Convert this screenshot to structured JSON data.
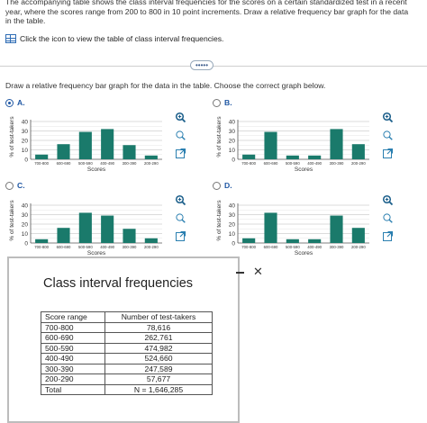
{
  "intro": "The accompanying table shows the class interval frequencies for the scores on a certain standardized test in a recent year, where the scores range from 200 to 800 in 10 point increments. Draw a relative frequency bar graph for the data in the table.",
  "table_link": "Click the icon to view the table of class interval frequencies.",
  "more_button": "•••••",
  "question": "Draw a relative frequency bar graph for the data in the table. Choose the correct graph below.",
  "graph_axes": {
    "ylabel": "% of test-takers",
    "xlabel": "Scores",
    "yticks": [
      "0",
      "10",
      "20",
      "30",
      "40"
    ]
  },
  "chart_data": [
    {
      "option": "A.",
      "selected": true,
      "type": "bar",
      "categories": [
        "700-800",
        "600-690",
        "500-590",
        "400-490",
        "300-390",
        "200-290"
      ],
      "values": [
        5,
        16,
        29,
        32,
        15,
        4
      ],
      "ylim": [
        0,
        40
      ],
      "xlabel": "Scores",
      "ylabel": "% of test-takers"
    },
    {
      "option": "B.",
      "selected": false,
      "type": "bar",
      "categories": [
        "700-800",
        "600-690",
        "500-590",
        "400-490",
        "300-390",
        "200-290"
      ],
      "values": [
        5,
        29,
        4,
        4,
        32,
        16
      ],
      "ylim": [
        0,
        40
      ],
      "xlabel": "Scores",
      "ylabel": "% of test-takers"
    },
    {
      "option": "C.",
      "selected": false,
      "type": "bar",
      "categories": [
        "700-800",
        "600-690",
        "500-590",
        "400-490",
        "300-390",
        "200-290"
      ],
      "values": [
        4,
        16,
        32,
        29,
        15,
        5
      ],
      "ylim": [
        0,
        40
      ],
      "xlabel": "Scores",
      "ylabel": "% of test-takers"
    },
    {
      "option": "D.",
      "selected": false,
      "type": "bar",
      "categories": [
        "700-800",
        "600-690",
        "500-590",
        "400-490",
        "300-390",
        "200-290"
      ],
      "values": [
        5,
        32,
        4,
        4,
        29,
        16
      ],
      "ylim": [
        0,
        40
      ],
      "xlabel": "Scores",
      "ylabel": "% of test-takers"
    }
  ],
  "popup": {
    "title": "Class interval frequencies",
    "minimize": "",
    "close": "✕",
    "headers": [
      "Score range",
      "Number of test-takers"
    ],
    "rows": [
      [
        "700-800",
        "78,616"
      ],
      [
        "600-690",
        "262,761"
      ],
      [
        "500-590",
        "474,982"
      ],
      [
        "400-490",
        "524,660"
      ],
      [
        "300-390",
        "247,589"
      ],
      [
        "200-290",
        "57,677"
      ],
      [
        "Total",
        "N = 1,646,285"
      ]
    ]
  },
  "colors": {
    "bar": "#1a7a6b",
    "accent": "#1f57a3"
  }
}
